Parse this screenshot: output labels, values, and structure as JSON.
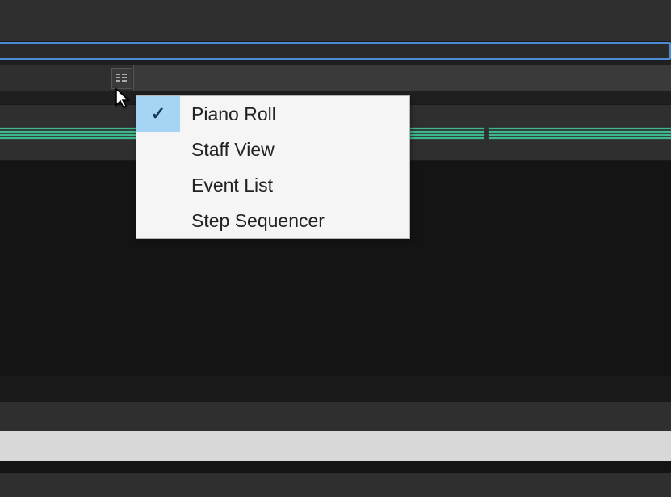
{
  "menu": {
    "items": [
      {
        "label": "Piano Roll",
        "selected": true
      },
      {
        "label": "Staff View",
        "selected": false
      },
      {
        "label": "Event List",
        "selected": false
      },
      {
        "label": "Step Sequencer",
        "selected": false
      }
    ]
  }
}
